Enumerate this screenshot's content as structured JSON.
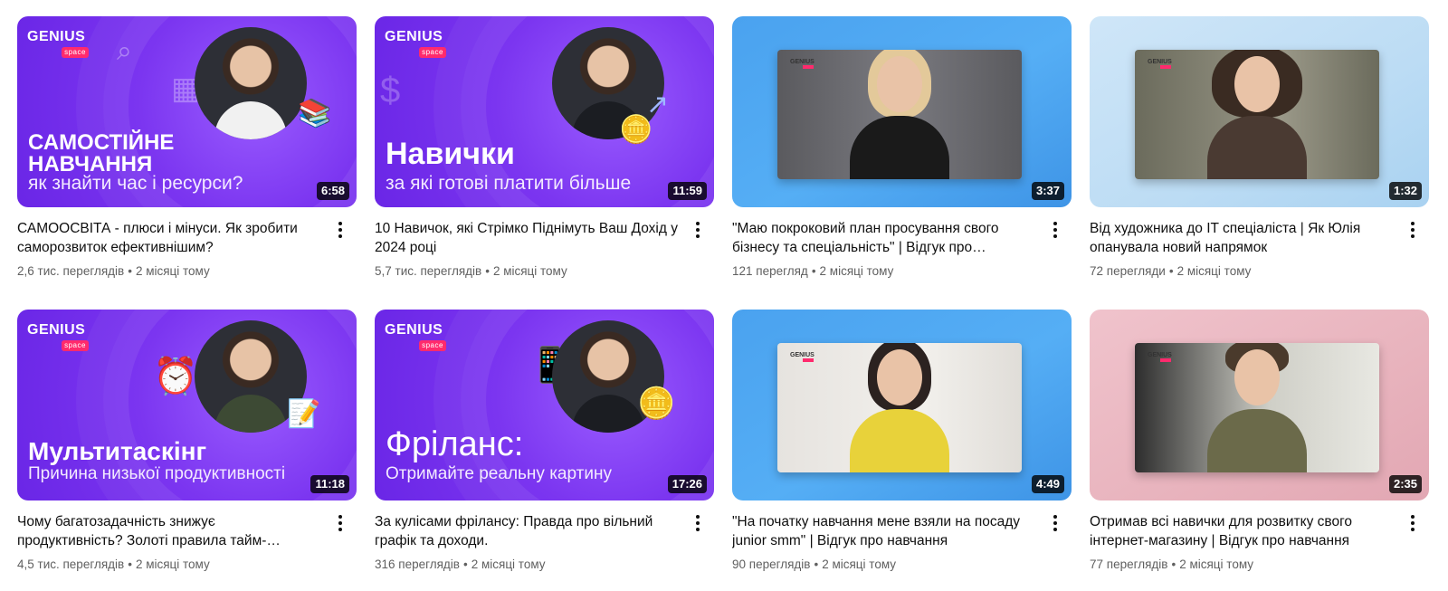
{
  "videos": [
    {
      "thumb_style": "purple",
      "logo": "GENIUS",
      "logo_sub": "space",
      "thumb_title_1": "САМОСТІЙНЕ",
      "thumb_title_2": "НАВЧАННЯ",
      "thumb_subtitle": "як знайти час і ресурси?",
      "duration": "6:58",
      "title": "САМООСВІТА - плюси і мінуси. Як зробити саморозвиток ефективнішим?",
      "views": "2,6 тис. переглядів",
      "age": "2 місяці тому"
    },
    {
      "thumb_style": "purple",
      "logo": "GENIUS",
      "logo_sub": "space",
      "thumb_title_1": "Навички",
      "thumb_subtitle": "за які готові платити більше",
      "duration": "11:59",
      "title": "10 Навичок, які Стрімко Піднімуть Ваш Дохід у 2024 році",
      "views": "5,7 тис. переглядів",
      "age": "2 місяці тому"
    },
    {
      "thumb_style": "blue",
      "mini_logo": "GENIUS",
      "duration": "3:37",
      "title": "\"Маю покроковий план просування свого бізнесу та спеціальність\" | Відгук про навчання",
      "views": "121 перегляд",
      "age": "2 місяці тому"
    },
    {
      "thumb_style": "lightblue",
      "mini_logo": "GENIUS",
      "duration": "1:32",
      "title": "Від художника до IT спеціаліста | Як Юлія опанувала новий напрямок",
      "views": "72 перегляди",
      "age": "2 місяці тому"
    },
    {
      "thumb_style": "purple",
      "logo": "GENIUS",
      "logo_sub": "space",
      "thumb_title_1": "Мультитаскінг",
      "thumb_subtitle": "Причина низької продуктивності",
      "duration": "11:18",
      "title": "Чому багатозадачність знижує продуктивність? Золоті правила тайм-менеджменту",
      "views": "4,5 тис. переглядів",
      "age": "2 місяці тому"
    },
    {
      "thumb_style": "purple",
      "logo": "GENIUS",
      "logo_sub": "space",
      "thumb_title_1": "Фріланс:",
      "thumb_subtitle": "Отримайте реальну картину",
      "duration": "17:26",
      "title": "За кулісами фрілансу: Правда про вільний графік та доходи.",
      "views": "316 переглядів",
      "age": "2 місяці тому"
    },
    {
      "thumb_style": "blue",
      "mini_logo": "GENIUS",
      "duration": "4:49",
      "title": "\"На початку навчання мене взяли на посаду junior smm\" | Відгук про навчання",
      "views": "90 переглядів",
      "age": "2 місяці тому"
    },
    {
      "thumb_style": "pink",
      "mini_logo": "GENIUS",
      "duration": "2:35",
      "title": "Отримав всі навички для розвитку свого інтернет-магазину | Відгук про навчання",
      "views": "77 переглядів",
      "age": "2 місяці тому"
    }
  ],
  "icons": {
    "more": "more-vert-icon"
  },
  "colors": {
    "brand_purple": "#7b35f0",
    "brand_pink": "#ff2a6d",
    "meta_gray": "#606060"
  }
}
